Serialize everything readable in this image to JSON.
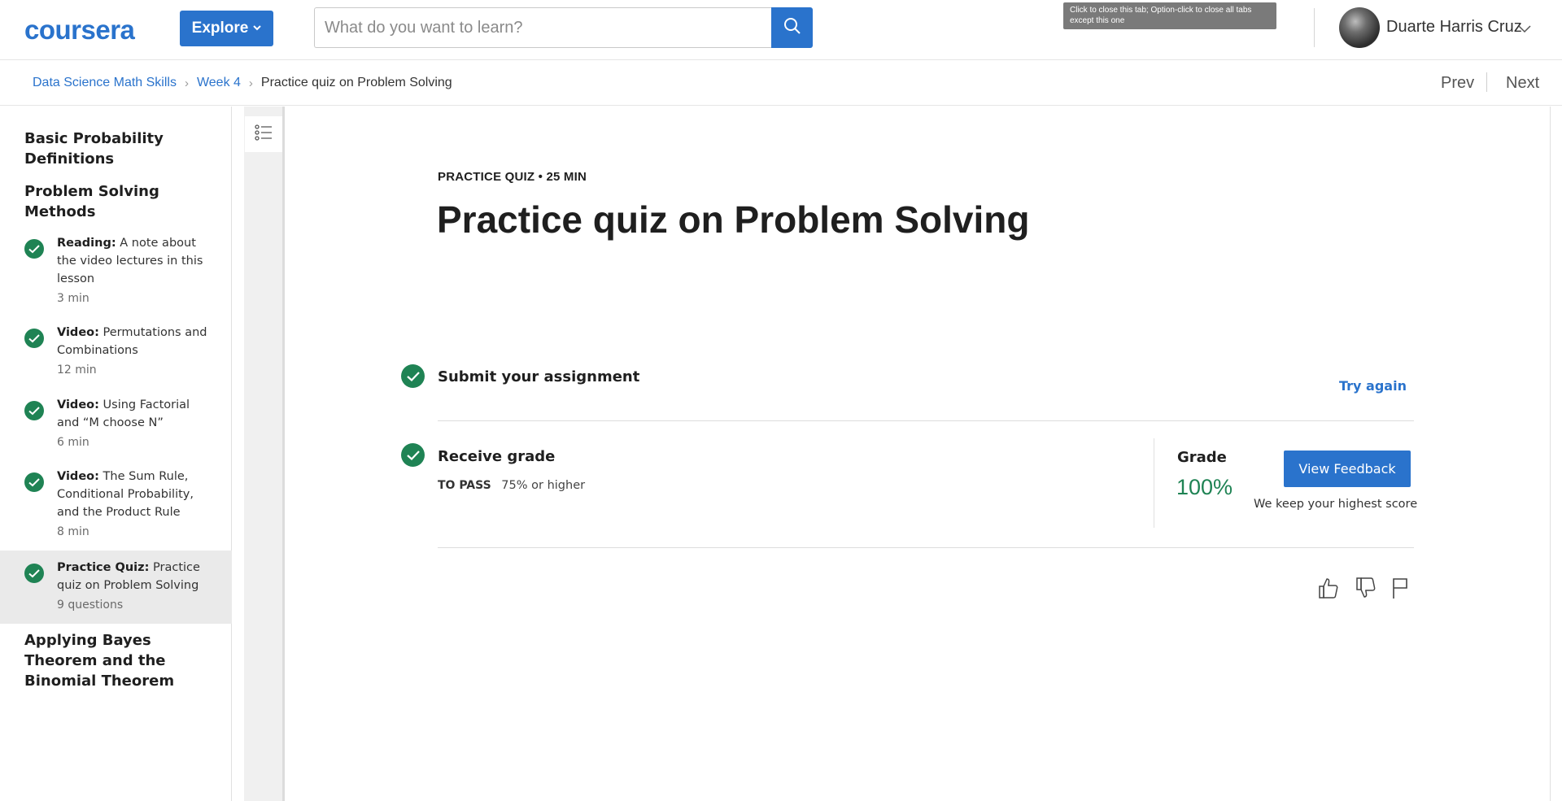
{
  "header": {
    "logo": "coursera",
    "explore_label": "Explore",
    "search_placeholder": "What do you want to learn?",
    "tab_tooltip": "Click to close this tab; Option-click to close all tabs except this one",
    "user_name": "Duarte Harris Cruz"
  },
  "breadcrumb": {
    "items": [
      "Data Science Math Skills",
      "Week 4"
    ],
    "current": "Practice quiz on Problem Solving"
  },
  "nav": {
    "prev": "Prev",
    "next": "Next"
  },
  "sidebar": {
    "section_1": "Basic Probability Definitions",
    "section_2": "Problem Solving Methods",
    "items": [
      {
        "type": "Reading:",
        "title": "A note about the video lectures in this lesson",
        "meta": "3 min"
      },
      {
        "type": "Video:",
        "title": "Permutations and Combinations",
        "meta": "12 min"
      },
      {
        "type": "Video:",
        "title": "Using Factorial and “M choose N”",
        "meta": "6 min"
      },
      {
        "type": "Video:",
        "title": "The Sum Rule, Conditional Probability, and the Product Rule",
        "meta": "8 min"
      },
      {
        "type": "Practice Quiz:",
        "title": "Practice quiz on Problem Solving",
        "meta": "9 questions"
      }
    ],
    "section_3": "Applying Bayes Theorem and the Binomial Theorem"
  },
  "main": {
    "eyebrow": "PRACTICE QUIZ • 25 MIN",
    "title": "Practice quiz on Problem Solving",
    "submit_title": "Submit your assignment",
    "try_again": "Try again",
    "receive_title": "Receive grade",
    "to_pass_label": "TO PASS",
    "to_pass_value": "75% or higher",
    "grade_label": "Grade",
    "grade_value": "100%",
    "view_feedback": "View Feedback",
    "keep_note": "We keep your highest score"
  },
  "colors": {
    "brand_blue": "#2a73cc",
    "success_green": "#1f8354"
  },
  "icons": [
    "search-icon",
    "chevron-down-icon",
    "check-icon",
    "outline-list-icon",
    "thumbs-up-icon",
    "thumbs-down-icon",
    "flag-icon"
  ]
}
